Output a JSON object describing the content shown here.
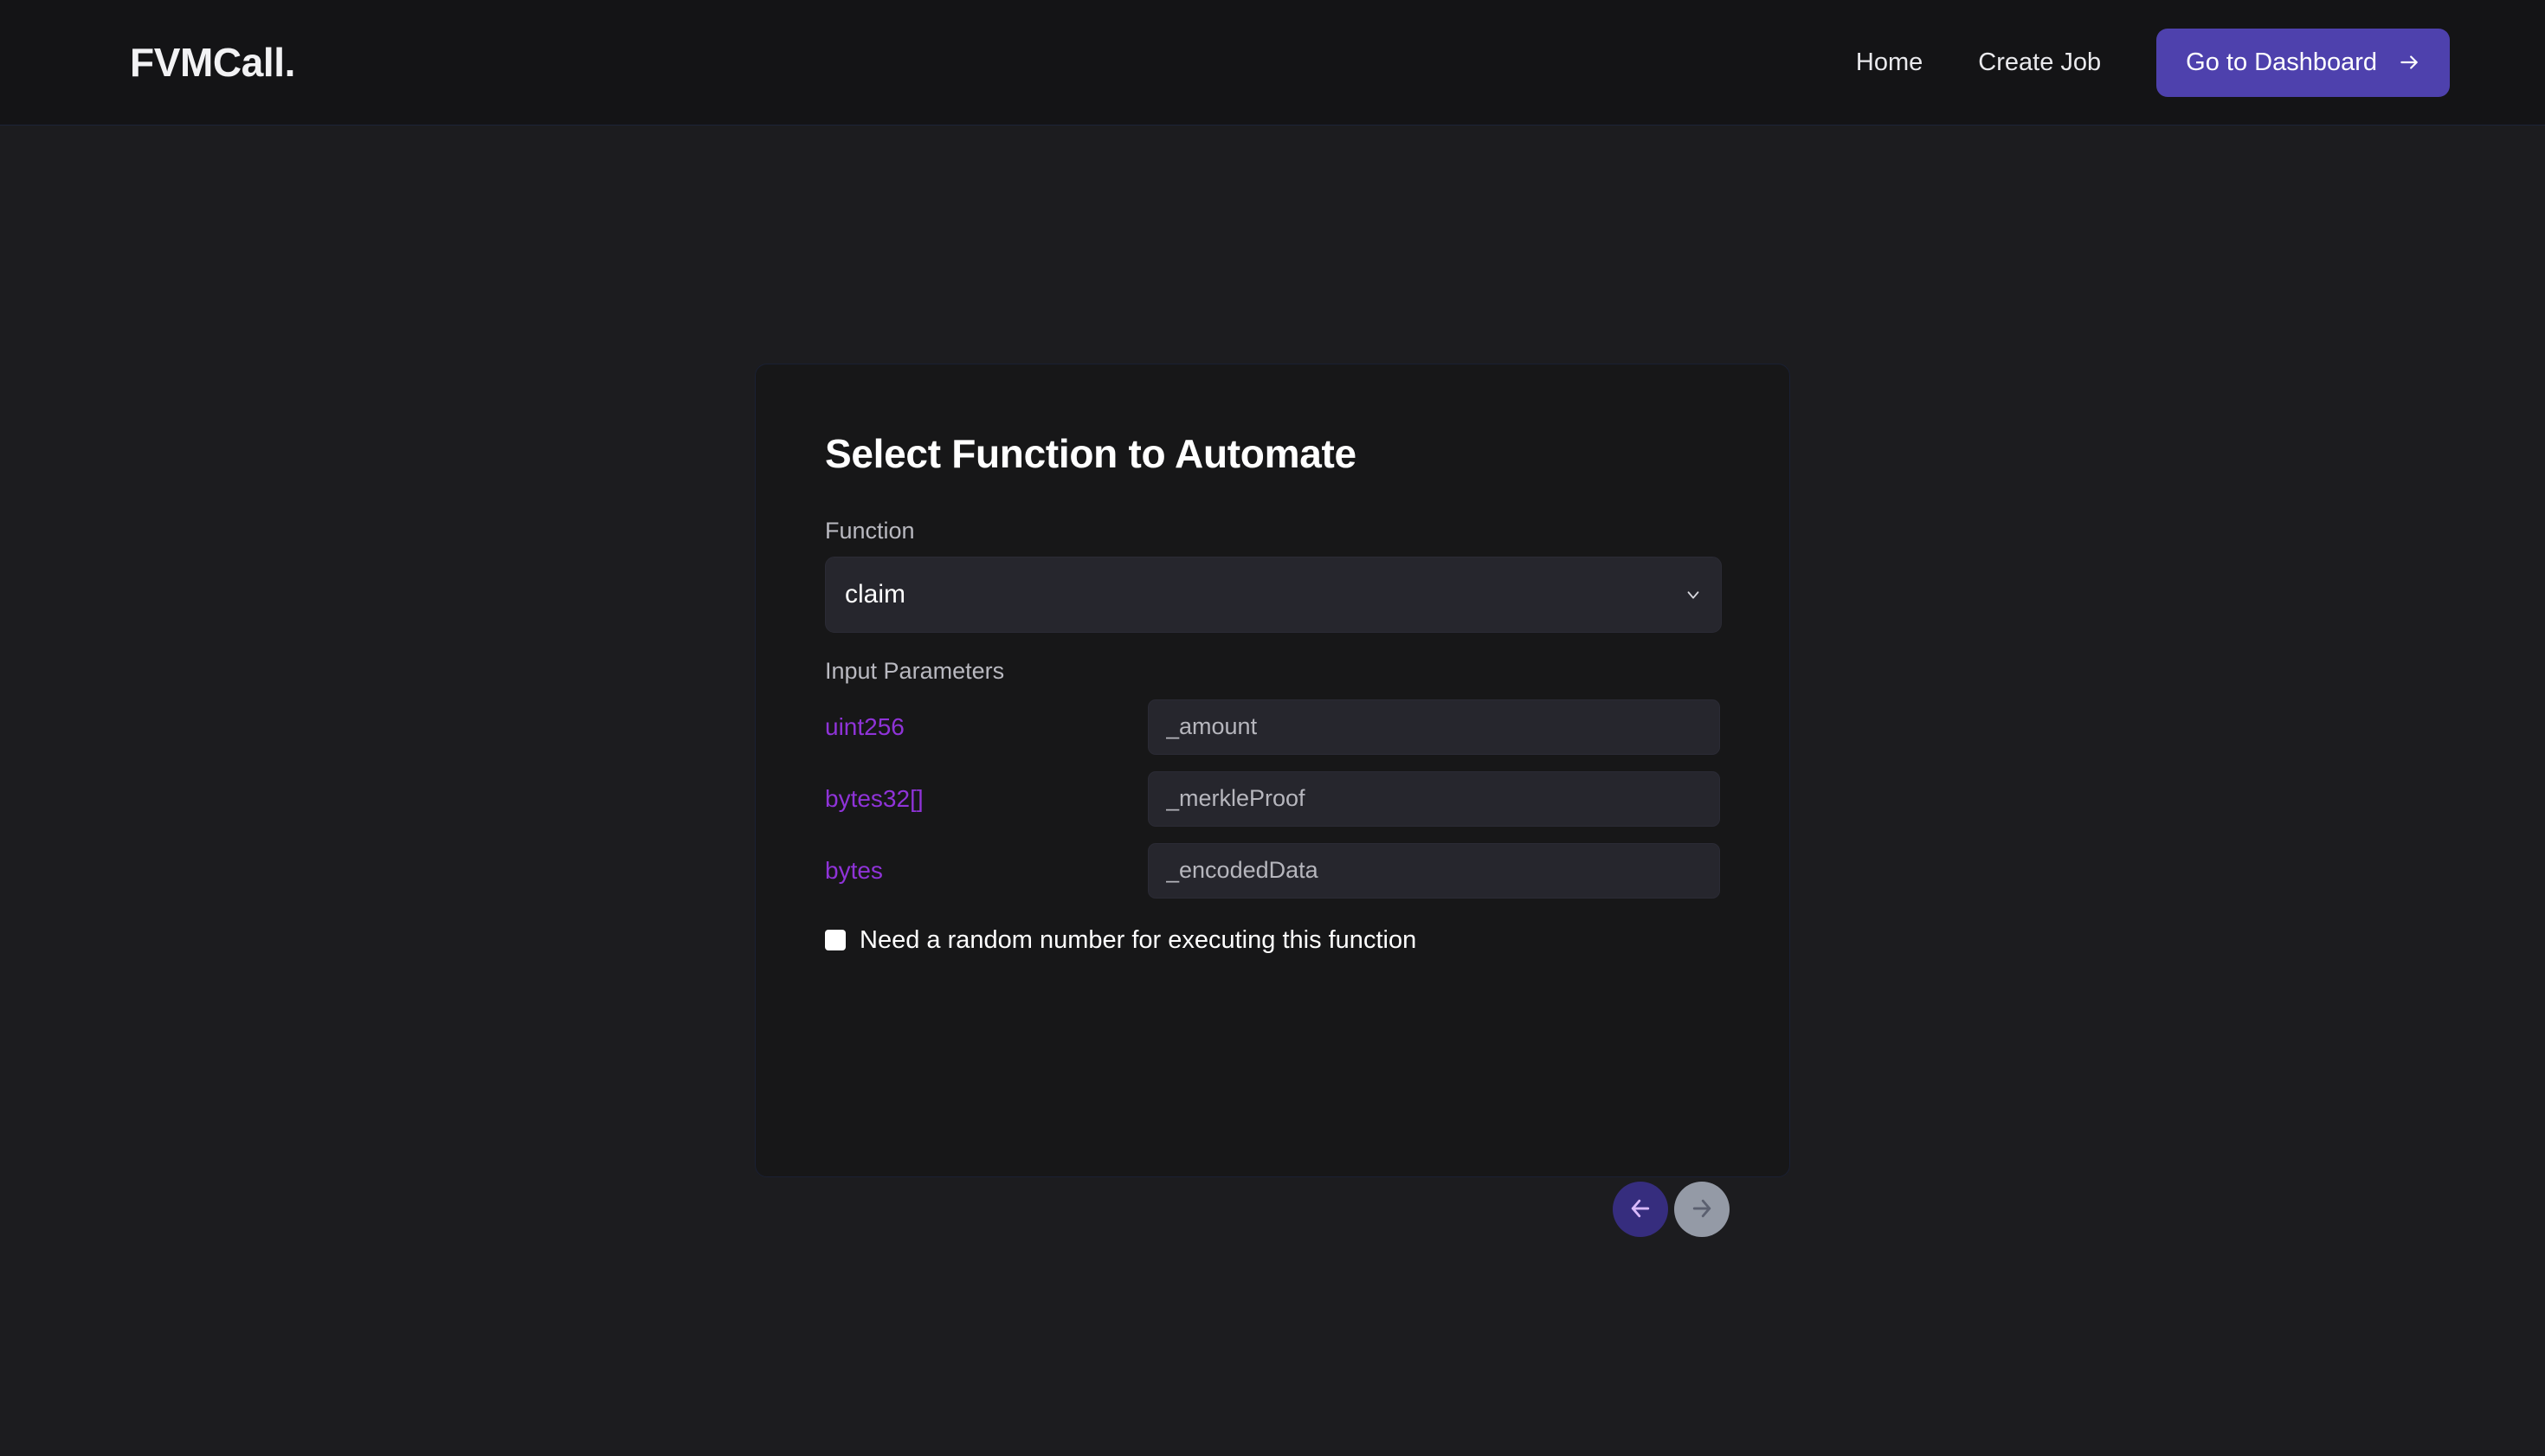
{
  "header": {
    "brand": "FVMCall.",
    "nav_links": [
      {
        "label": "Home"
      },
      {
        "label": "Create Job"
      }
    ],
    "cta": {
      "label": "Go to Dashboard",
      "icon": "arrow-right-icon",
      "color": "#4e41ad"
    }
  },
  "card": {
    "title": "Select Function to Automate",
    "function_field": {
      "label": "Function",
      "selected": "claim",
      "options": [
        "claim"
      ],
      "chevron_icon": "chevron-down-icon"
    },
    "params_section": {
      "label": "Input Parameters",
      "type_color": "#8f33d8",
      "rows": [
        {
          "type": "uint256",
          "placeholder": "_amount",
          "value": ""
        },
        {
          "type": "bytes32[]",
          "placeholder": "_merkleProof",
          "value": ""
        },
        {
          "type": "bytes",
          "placeholder": "_encodedData",
          "value": ""
        }
      ]
    },
    "random_checkbox": {
      "label": "Need a random number for executing this function",
      "checked": false
    }
  },
  "wizard_nav": {
    "prev": {
      "icon": "arrow-left-icon",
      "color": "#362d7e",
      "enabled": true
    },
    "next": {
      "icon": "arrow-right-icon",
      "color": "#949aa6",
      "enabled": false
    }
  }
}
